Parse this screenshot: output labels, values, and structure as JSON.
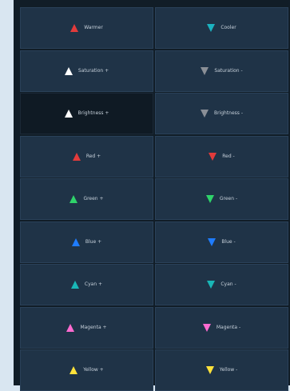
{
  "buttons": [
    {
      "label": "Warmer",
      "icon": "triangle-up-icon",
      "color": "#e23b3b"
    },
    {
      "label": "Cooler",
      "icon": "triangle-down-icon",
      "color": "#1bb2c0"
    },
    {
      "label": "Saturation +",
      "icon": "triangle-up-icon",
      "color": "#ffffff"
    },
    {
      "label": "Saturation -",
      "icon": "triangle-down-icon",
      "color": "#8a8f96"
    },
    {
      "label": "Brightness +",
      "icon": "triangle-up-icon",
      "color": "#ffffff",
      "active": true
    },
    {
      "label": "Brightness -",
      "icon": "triangle-down-icon",
      "color": "#8a8f96"
    },
    {
      "label": "Red +",
      "icon": "triangle-up-icon",
      "color": "#e23b3b"
    },
    {
      "label": "Red -",
      "icon": "triangle-down-icon",
      "color": "#e23b3b"
    },
    {
      "label": "Green +",
      "icon": "triangle-up-icon",
      "color": "#2fd36a"
    },
    {
      "label": "Green -",
      "icon": "triangle-down-icon",
      "color": "#2fd36a"
    },
    {
      "label": "Blue +",
      "icon": "triangle-up-icon",
      "color": "#1f7cff"
    },
    {
      "label": "Blue -",
      "icon": "triangle-down-icon",
      "color": "#1f7cff"
    },
    {
      "label": "Cyan +",
      "icon": "triangle-up-icon",
      "color": "#19b6b6"
    },
    {
      "label": "Cyan -",
      "icon": "triangle-down-icon",
      "color": "#19b6b6"
    },
    {
      "label": "Magenta +",
      "icon": "triangle-up-icon",
      "color": "#ff6bd0"
    },
    {
      "label": "Magenta -",
      "icon": "triangle-down-icon",
      "color": "#ff6bd0"
    },
    {
      "label": "Yellow +",
      "icon": "triangle-up-icon",
      "color": "#ffe23a"
    },
    {
      "label": "Yellow -",
      "icon": "triangle-down-icon",
      "color": "#ffe23a"
    }
  ]
}
